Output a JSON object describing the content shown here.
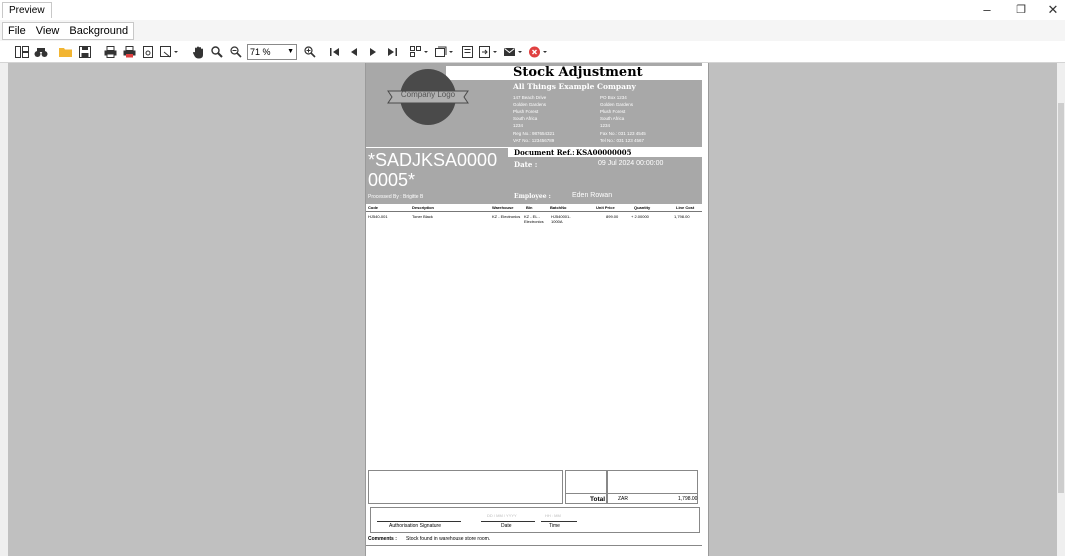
{
  "window": {
    "title": "Preview",
    "minimize": "–",
    "restore": "❐",
    "close": "✕"
  },
  "menu": {
    "items": [
      "File",
      "View",
      "Background"
    ]
  },
  "toolbar": {
    "zoom_value": "71 %",
    "icons": [
      "thumbnails-icon",
      "find-icon",
      "open-icon",
      "save-icon",
      "print-icon",
      "quick-print-icon",
      "page-setup-icon",
      "scale-icon",
      "hand-tool-icon",
      "magnifier-icon",
      "zoom-out-icon",
      "zoom-in-icon",
      "first-page-icon",
      "previous-page-icon",
      "next-page-icon",
      "last-page-icon",
      "multiple-pages-icon",
      "background-icon",
      "export-icon",
      "export-to-icon",
      "send-email-icon",
      "close-preview-icon"
    ]
  },
  "report": {
    "title": "Stock Adjustment",
    "company_name": "All Things Example Company",
    "logo_text": "Company Logo",
    "address_left": [
      "147 Beach Drive",
      "Golden Gardens",
      "Plush Forest",
      "South Africa",
      "1234"
    ],
    "address_right": [
      "PO Box 1234",
      "Golden Gardens",
      "Plush Forest",
      "South Africa",
      "1234"
    ],
    "reg_label": "Reg No.:",
    "reg_value": "987654321",
    "vat_label": "VAT No.:",
    "vat_value": "123456789",
    "fax_label": "Fax No.:",
    "fax_value": "031 123 4545",
    "tel_label": "Tel No.:",
    "tel_value": "031 123 4567",
    "big_code": "*SADJKSA0000 0005*",
    "doc_ref_label": "Document Ref.:",
    "doc_ref_value": "KSA00000005",
    "date_label": "Date :",
    "date_value": "09 Jul 2024 00:00:00",
    "processed_by": "Processed By : Brigitte B",
    "employee_label": "Employee :",
    "employee_value": "Eden Rowan",
    "columns": [
      "Code",
      "Description",
      "Warehouse",
      "Bin",
      "BatchNo",
      "Unit Price",
      "Quantity",
      "Line Cost"
    ],
    "rows": [
      {
        "code": "HJ540-001",
        "description": "Toner Black",
        "warehouse": "KZ - Electronics",
        "bin": "KZ - EL - Electronics",
        "batch": "HJ540001-1000A",
        "unit_price": "899.00",
        "quantity": "+ 2.00000",
        "line_cost": "1,798.00"
      }
    ],
    "total_label": "Total",
    "total_currency": "ZAR",
    "total_value": "1,798.00",
    "sig_label": "Authorisation Signature",
    "date_col_label": "Date",
    "time_col_label": "Time",
    "date_placeholder": "DD / MM / YYYY",
    "time_placeholder": "HH : MM",
    "comments_label": "Comments :",
    "comments_value": "Stock found in warehouse store room."
  }
}
